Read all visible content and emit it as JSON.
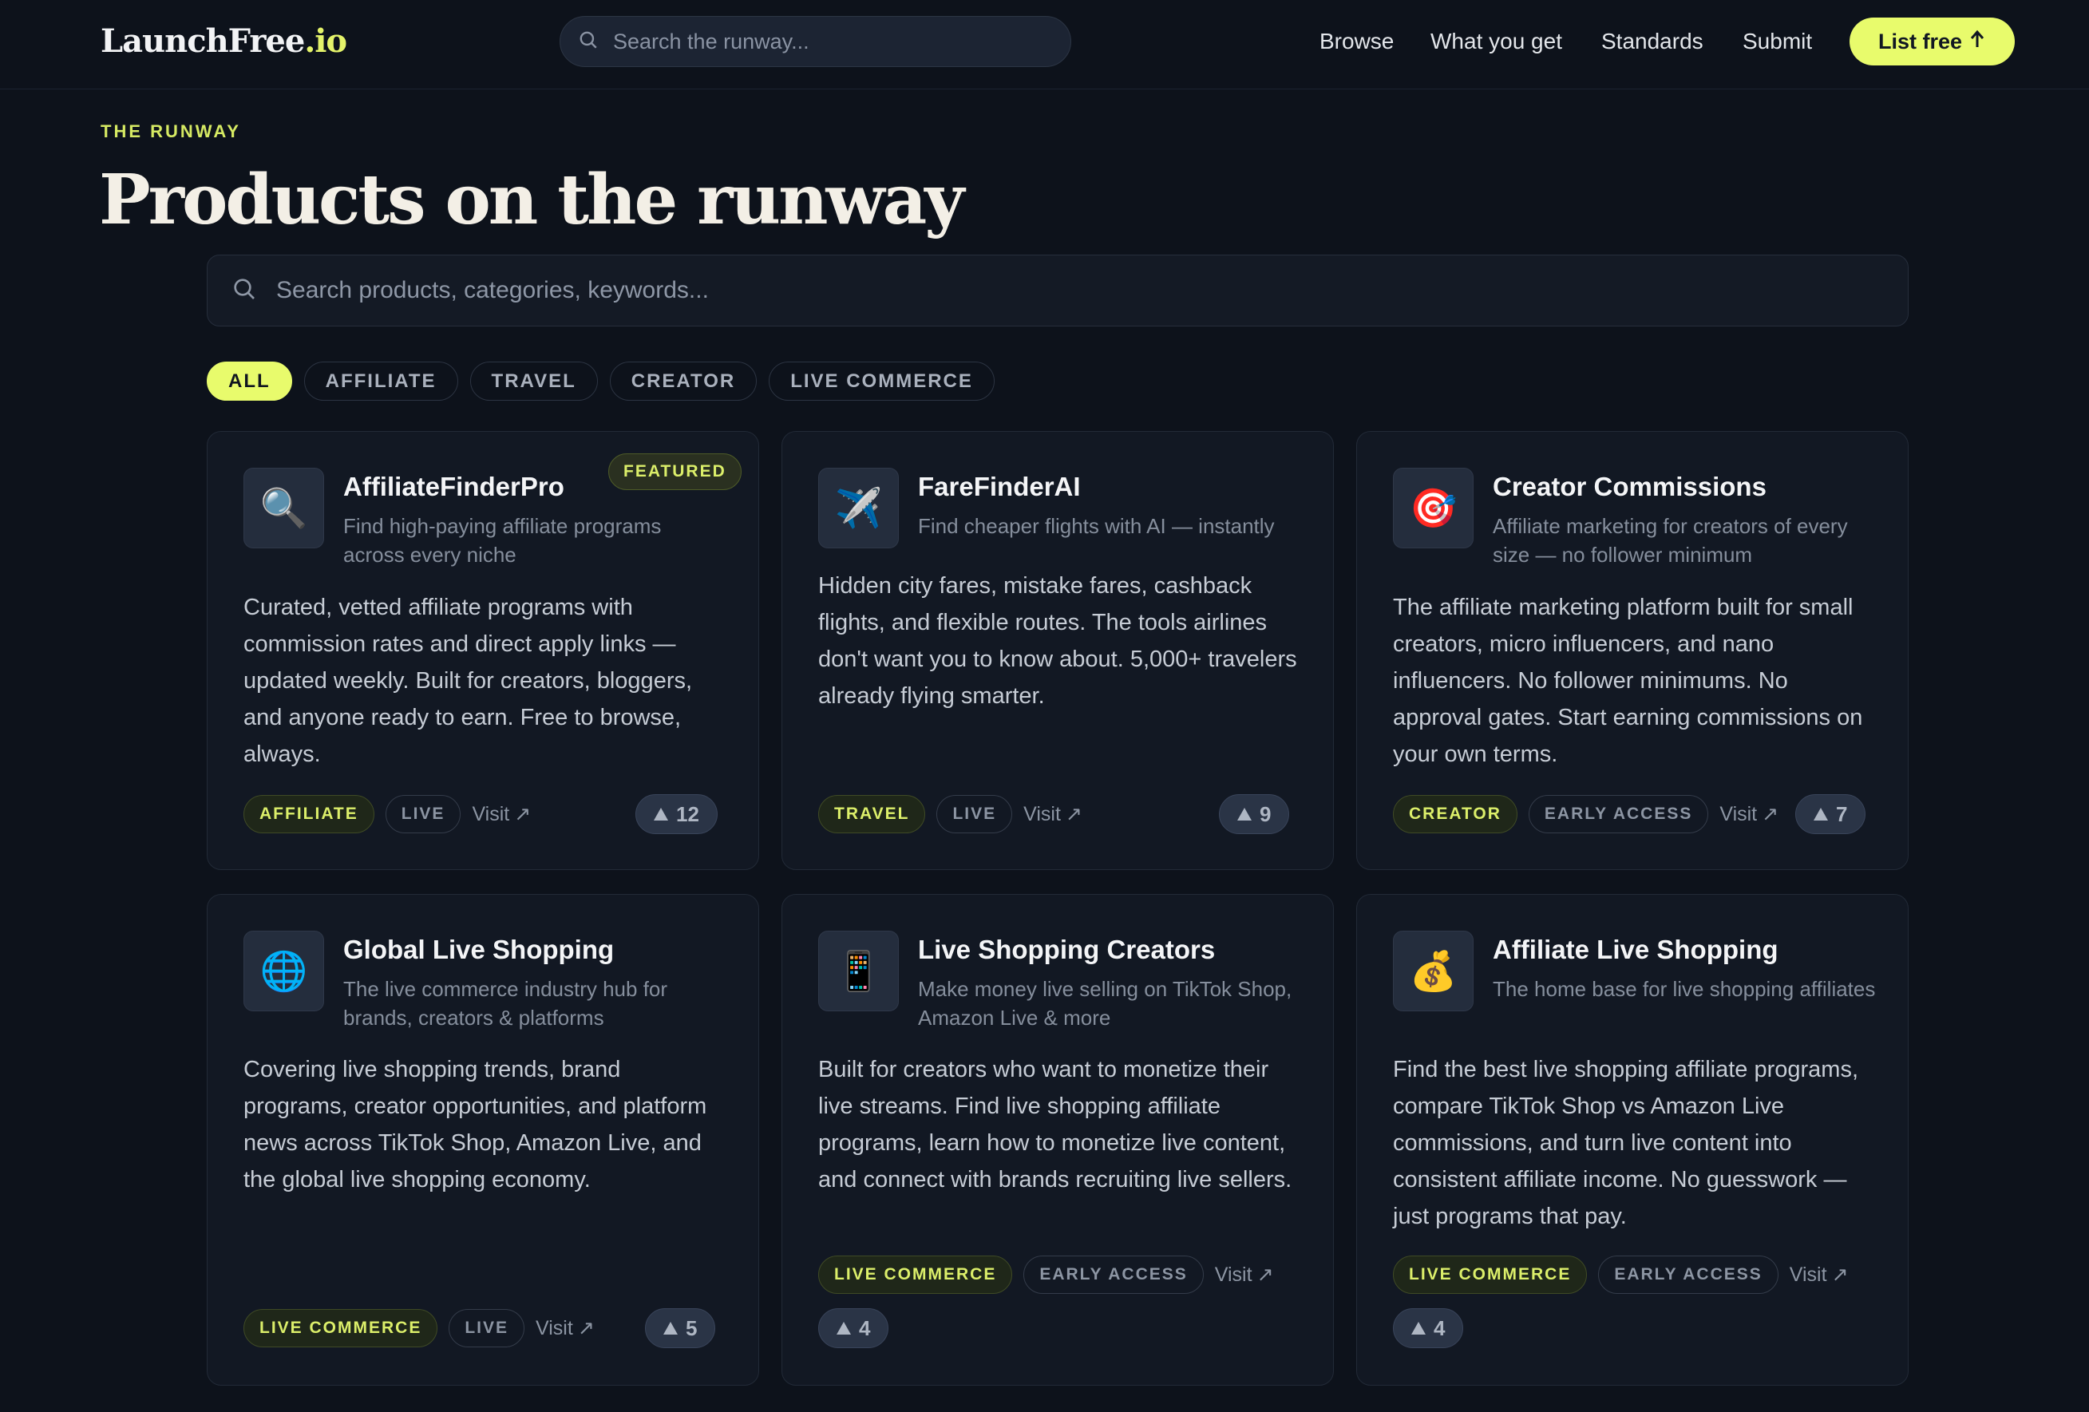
{
  "nav": {
    "brand_main": "LaunchFree",
    "brand_tld": ".io",
    "search_placeholder": "Search the runway...",
    "links": [
      "Browse",
      "What you get",
      "Standards",
      "Submit"
    ],
    "cta": "List free"
  },
  "hero": {
    "eyebrow": "THE RUNWAY",
    "title": "Products on the runway"
  },
  "search": {
    "placeholder": "Search products, categories, keywords..."
  },
  "filters": [
    "ALL",
    "AFFILIATE",
    "TRAVEL",
    "CREATOR",
    "LIVE COMMERCE"
  ],
  "active_filter": "ALL",
  "visit_label": "Visit",
  "products": [
    {
      "icon": "magnifying-glass-icon",
      "emoji": "🔍",
      "name": "AffiliateFinderPro",
      "tagline": "Find high-paying affiliate programs across every niche",
      "description": "Curated, vetted affiliate programs with commission rates and direct apply links — updated weekly. Built for creators, bloggers, and anyone ready to earn. Free to browse, always.",
      "badge": "FEATURED",
      "category": "AFFILIATE",
      "status": "LIVE",
      "votes": "12"
    },
    {
      "icon": "airplane-icon",
      "emoji": "✈️",
      "name": "FareFinderAI",
      "tagline": "Find cheaper flights with AI — instantly",
      "description": "Hidden city fares, mistake fares, cashback flights, and flexible routes. The tools airlines don't want you to know about. 5,000+ travelers already flying smarter.",
      "category": "TRAVEL",
      "status": "LIVE",
      "votes": "9"
    },
    {
      "icon": "target-icon",
      "emoji": "🎯",
      "name": "Creator Commissions",
      "tagline": "Affiliate marketing for creators of every size — no follower minimum",
      "description": "The affiliate marketing platform built for small creators, micro influencers, and nano influencers. No follower minimums. No approval gates. Start earning commissions on your own terms.",
      "category": "CREATOR",
      "status": "EARLY ACCESS",
      "votes": "7"
    },
    {
      "icon": "globe-icon",
      "emoji": "🌐",
      "name": "Global Live Shopping",
      "tagline": "The live commerce industry hub for brands, creators & platforms",
      "description": "Covering live shopping trends, brand programs, creator opportunities, and platform news across TikTok Shop, Amazon Live, and the global live shopping economy.",
      "category": "LIVE COMMERCE",
      "status": "LIVE",
      "votes": "5"
    },
    {
      "icon": "mobile-phone-icon",
      "emoji": "📱",
      "name": "Live Shopping Creators",
      "tagline": "Make money live selling on TikTok Shop, Amazon Live & more",
      "description": "Built for creators who want to monetize their live streams. Find live shopping affiliate programs, learn how to monetize live content, and connect with brands recruiting live sellers.",
      "category": "LIVE COMMERCE",
      "status": "EARLY ACCESS",
      "votes": "4"
    },
    {
      "icon": "money-bag-icon",
      "emoji": "💰",
      "name": "Affiliate Live Shopping",
      "tagline": "The home base for live shopping affiliates",
      "description": "Find the best live shopping affiliate programs, compare TikTok Shop vs Amazon Live commissions, and turn live content into consistent affiliate income. No guesswork — just programs that pay.",
      "category": "LIVE COMMERCE",
      "status": "EARLY ACCESS",
      "votes": "4"
    }
  ],
  "colors": {
    "background": "#0d121b",
    "accent": "#e8fb6c",
    "card": "#121823"
  }
}
